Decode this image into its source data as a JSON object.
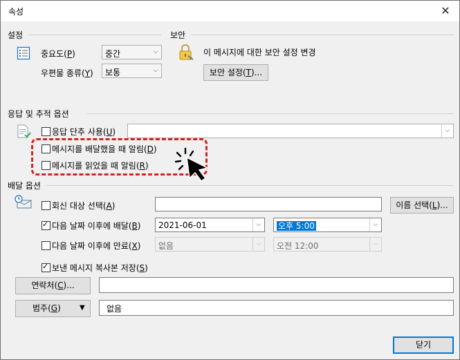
{
  "window": {
    "title": "속성",
    "close_glyph": "✕"
  },
  "settings": {
    "section": "설정",
    "importance_label": "중요도(",
    "importance_key": "P",
    "importance_value": "중간",
    "sensitivity_label": "우편물 종류(",
    "sensitivity_key": "Y",
    "sensitivity_value": "보통"
  },
  "security": {
    "section": "보안",
    "text": "이 메시지에 대한 보안 설정 변경",
    "button": "보안 설정(",
    "button_key": "T",
    "button_suffix": ")..."
  },
  "tracking": {
    "section": "응답 및 추적 옵션",
    "voting_label": "응답 단추 사용(",
    "voting_key": "U",
    "delivery_receipt": "메시지를 배달했을 때 알림(",
    "delivery_key": "D",
    "read_receipt": "메시지를 읽었을 때 알림(",
    "read_key": "R"
  },
  "delivery": {
    "section": "배달 옵션",
    "replies_label": "회신 대상 선택(",
    "replies_key": "A",
    "select_names": "이름 선택(",
    "select_names_key": "L",
    "select_names_suffix": ")...",
    "defer_label": "다음 날짜 이후에 배달(",
    "defer_key": "B",
    "defer_date": "2021-06-01",
    "defer_time": "오후 5:00",
    "expire_label": "다음 날짜 이후에 만료(",
    "expire_key": "X",
    "expire_date": "없음",
    "expire_time": "오전 12:00",
    "save_copy_label": "보낸 메시지 복사본 저장(",
    "save_copy_key": "S"
  },
  "contacts": {
    "button": "연락처(",
    "key": "C",
    "suffix": ")..."
  },
  "categories": {
    "button": "범주(",
    "key": "G",
    "value": "없음"
  },
  "close_button": "닫기",
  "glyphs": {
    "arrow_down": "⌵",
    "caret": "▼",
    "paren": ")"
  }
}
